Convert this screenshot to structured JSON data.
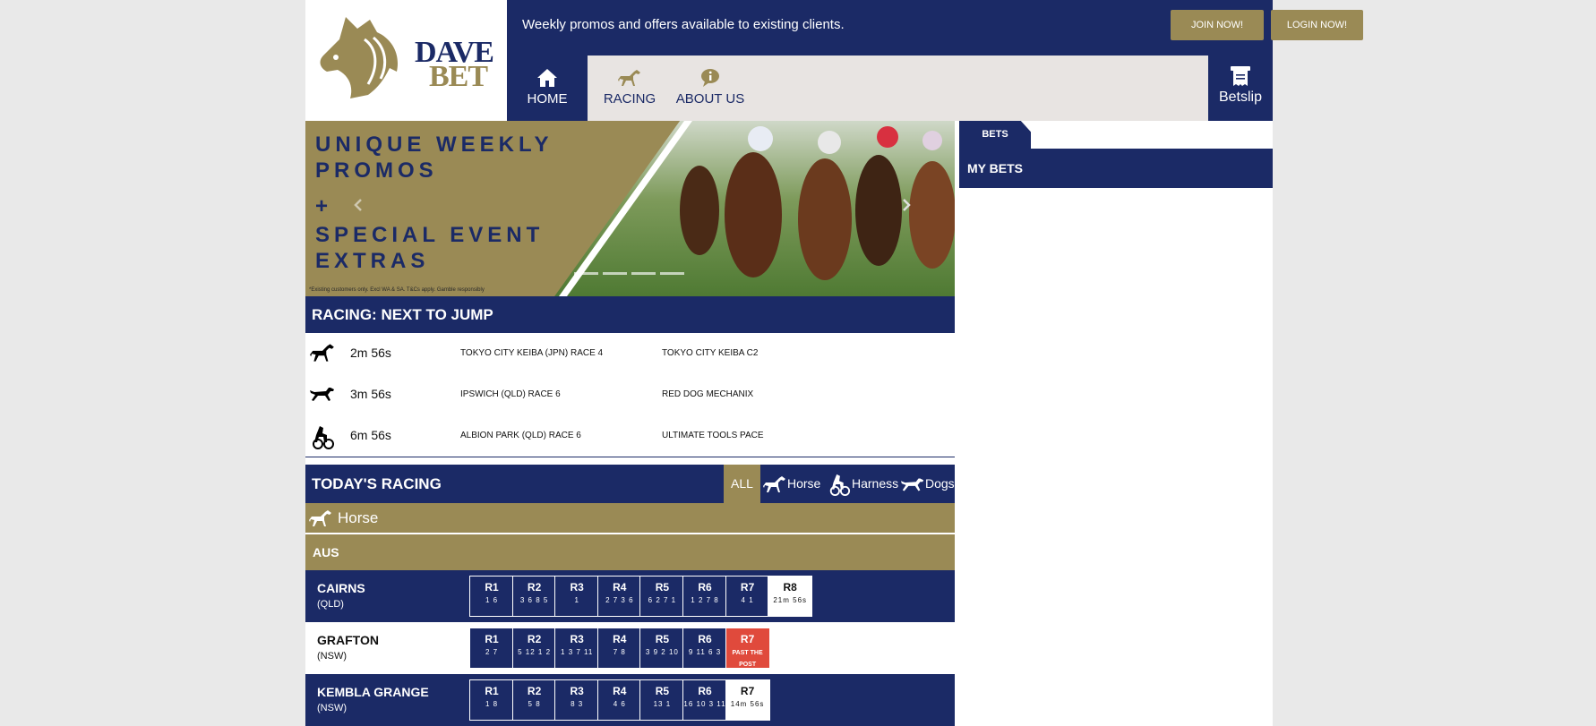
{
  "header": {
    "logo_line1": "DAVE",
    "logo_line2": "BET",
    "promo_text": "Weekly promos and offers available to existing clients.",
    "join_label": "JOIN NOW!",
    "login_label": "LOGIN NOW!"
  },
  "nav": {
    "home": "HOME",
    "racing": "RACING",
    "about": "ABOUT US",
    "betslip": "Betslip"
  },
  "banner": {
    "line1": "UNIQUE WEEKLY",
    "line2": "PROMOS",
    "line3": "+",
    "line4": "SPECIAL EVENT",
    "line5": "EXTRAS",
    "fine_print": "*Existing customers only. Excl WA & SA. T&Cs apply. Gamble responsibly"
  },
  "next_to_jump": {
    "title": "RACING: NEXT TO JUMP",
    "rows": [
      {
        "type": "horse-icon",
        "time": "2m 56s",
        "venue": "TOKYO CITY KEIBA (JPN) RACE 4",
        "name": "TOKYO CITY KEIBA C2"
      },
      {
        "type": "dog-icon",
        "time": "3m 56s",
        "venue": "IPSWICH (QLD) RACE 6",
        "name": "RED DOG MECHANIX"
      },
      {
        "type": "harness-icon",
        "time": "6m 56s",
        "venue": "ALBION PARK (QLD) RACE 6",
        "name": "ULTIMATE TOOLS PACE"
      }
    ]
  },
  "todays_racing": {
    "title": "TODAY'S RACING",
    "filters": {
      "all": "ALL",
      "horse": "Horse",
      "harness": "Harness",
      "dogs": "Dogs"
    },
    "section": "Horse",
    "region": "AUS",
    "meetings": [
      {
        "name": "CAIRNS",
        "state": "(QLD)",
        "races": [
          {
            "r": "R1",
            "res": "1 6"
          },
          {
            "r": "R2",
            "res": "3 6 8 5"
          },
          {
            "r": "R3",
            "res": "1"
          },
          {
            "r": "R4",
            "res": "2 7 3 6"
          },
          {
            "r": "R5",
            "res": "6 2 7 1"
          },
          {
            "r": "R6",
            "res": "1 2 7 8"
          },
          {
            "r": "R7",
            "res": "4 1"
          },
          {
            "r": "R8",
            "res": "21m 56s",
            "status": "open"
          }
        ]
      },
      {
        "name": "GRAFTON",
        "state": "(NSW)",
        "races": [
          {
            "r": "R1",
            "res": "2 7"
          },
          {
            "r": "R2",
            "res": "5 12 1 2"
          },
          {
            "r": "R3",
            "res": "1 3 7 11"
          },
          {
            "r": "R4",
            "res": "7 8"
          },
          {
            "r": "R5",
            "res": "3 9 2 10"
          },
          {
            "r": "R6",
            "res": "9 11 6 3"
          },
          {
            "r": "R7",
            "res": "PAST THE POST",
            "status": "past"
          }
        ]
      },
      {
        "name": "KEMBLA GRANGE",
        "state": "(NSW)",
        "races": [
          {
            "r": "R1",
            "res": "1 8"
          },
          {
            "r": "R2",
            "res": "5 8"
          },
          {
            "r": "R3",
            "res": "8 3"
          },
          {
            "r": "R4",
            "res": "4 6"
          },
          {
            "r": "R5",
            "res": "13 1"
          },
          {
            "r": "R6",
            "res": "16 10 3 11"
          },
          {
            "r": "R7",
            "res": "14m 56s",
            "status": "open"
          }
        ]
      }
    ]
  },
  "side": {
    "tab": "BETS",
    "my_bets": "MY BETS"
  },
  "colors": {
    "navy": "#1b2a66",
    "gold": "#9a8a55",
    "red": "#e04a3c",
    "light": "#e8e4e2"
  }
}
